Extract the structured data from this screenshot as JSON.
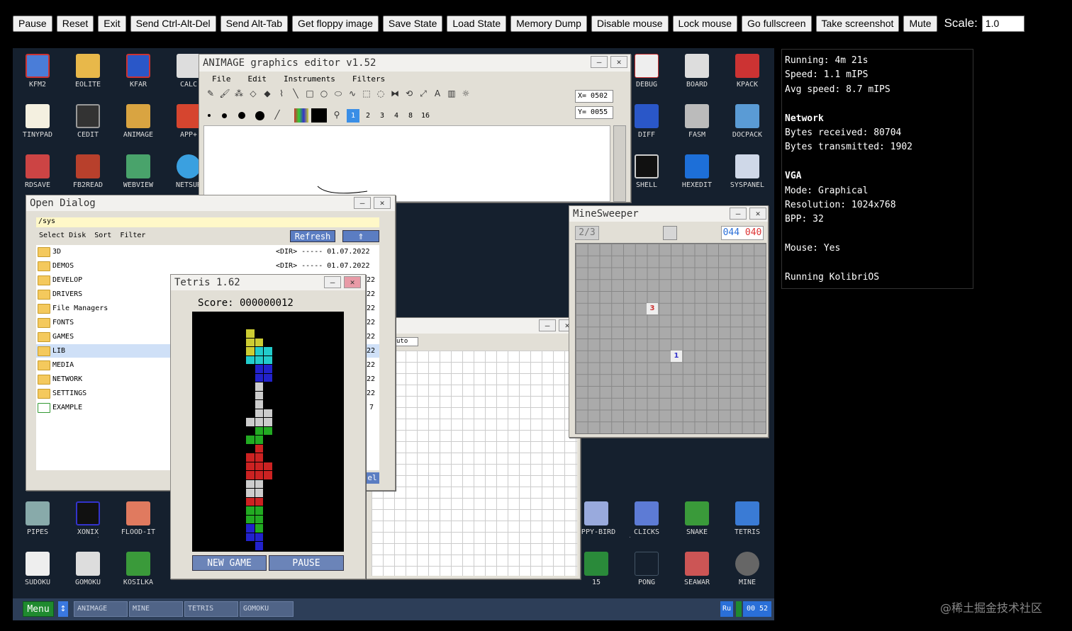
{
  "toolbar": {
    "buttons": [
      "Pause",
      "Reset",
      "Exit",
      "Send Ctrl-Alt-Del",
      "Send Alt-Tab",
      "Get floppy image",
      "Save State",
      "Load State",
      "Memory Dump",
      "Disable mouse",
      "Lock mouse",
      "Go fullscreen",
      "Take screenshot",
      "Mute"
    ],
    "scale_label": "Scale:",
    "scale_value": "1.0"
  },
  "info": {
    "running": "Running: 4m 21s",
    "speed": "Speed: 1.1 mIPS",
    "avg_speed": "Avg speed: 8.7 mIPS",
    "network_title": "Network",
    "bytes_received": "Bytes received: 80704",
    "bytes_transmitted": "Bytes transmitted: 1902",
    "vga_title": "VGA",
    "mode": "Mode: Graphical",
    "resolution": "Resolution: 1024x768",
    "bpp": "BPP: 32",
    "mouse": "Mouse: Yes",
    "os": "Running KolibriOS"
  },
  "desktop_icons_left": [
    "KFM2",
    "EOLITE",
    "KFAR",
    "CALC",
    "TINYPAD",
    "CEDIT",
    "ANIMAGE",
    "APP+",
    "RDSAVE",
    "FB2READ",
    "WEBVIEW",
    "NETSUR"
  ],
  "desktop_icons_right": [
    "DEBUG",
    "BOARD",
    "KPACK",
    "DIFF",
    "FASM",
    "DOCPACK",
    "SHELL",
    "HEXEDIT",
    "SYSPANEL"
  ],
  "desktop_icons_bottom_left": [
    "PIPES",
    "XONIX",
    "FLOOD-IT",
    "SUDOKU",
    "GOMOKU",
    "KOSILKA"
  ],
  "desktop_icons_bottom_right": [
    "APPY-BIRD",
    "CLICKS",
    "SNAKE",
    "TETRIS",
    "15",
    "PONG",
    "SEAWAR",
    "MINE"
  ],
  "animage": {
    "title": "ANIMAGE graphics editor v1.52",
    "menu": [
      "File",
      "Edit",
      "Instruments",
      "Filters"
    ],
    "x_coord": "X= 0502",
    "y_coord": "Y= 0055",
    "sizes": [
      "1",
      "2",
      "3",
      "4",
      "8",
      "16"
    ]
  },
  "open_dialog": {
    "title": "Open Dialog",
    "path": "/sys",
    "menu": [
      "Select Disk",
      "Sort",
      "Filter"
    ],
    "refresh": "Refresh",
    "up_symbol": "⇑",
    "dir_marker": "<DIR>",
    "dash": "-----",
    "date": "01.07.2022",
    "files": [
      "3D",
      "DEMOS",
      "DEVELOP",
      "DRIVERS",
      "File Managers",
      "FONTS",
      "GAMES",
      "LIB",
      "MEDIA",
      "NETWORK",
      "SETTINGS",
      "EXAMPLE"
    ],
    "date_tails": [
      "22",
      "22",
      "22",
      "22",
      "22",
      "22",
      "22",
      "22",
      "22",
      "7"
    ],
    "cancel_fragment": "el"
  },
  "tetris": {
    "title": "Tetris 1.62",
    "score": "Score: 000000012",
    "new_game": "NEW GAME",
    "pause": "PAUSE"
  },
  "back_window": {
    "field_value": "uto"
  },
  "minesweeper": {
    "title": "MineSweeper",
    "flags": "2/3",
    "counter_a": "044",
    "counter_b": "040",
    "cell_3": "3",
    "cell_1": "1"
  },
  "taskbar": {
    "menu": "Menu",
    "arrow": "↕",
    "items": [
      "ANIMAGE",
      "MINE",
      "TETRIS",
      "GOMOKU"
    ],
    "lang": "Ru",
    "clock": "00 52"
  },
  "watermark": "@稀土掘金技术社区"
}
